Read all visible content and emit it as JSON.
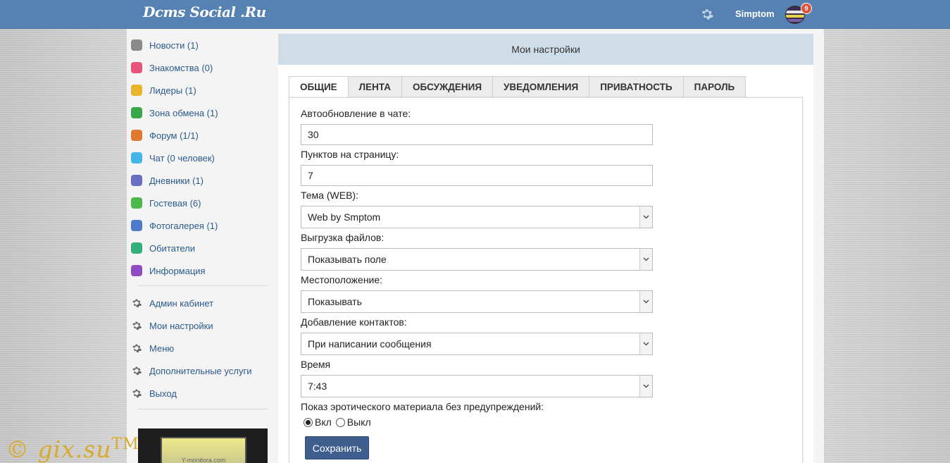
{
  "header": {
    "logo": "Dcms Social .Ru",
    "username": "Simptom",
    "notifications_count": "9"
  },
  "sidebar": {
    "items": [
      {
        "label": "Новости (1)",
        "icon": "news-icon",
        "color": "#8a8a8a"
      },
      {
        "label": "Знакомства (0)",
        "icon": "heart-icon",
        "color": "#e8557a"
      },
      {
        "label": "Лидеры (1)",
        "icon": "trophy-icon",
        "color": "#e8b52a"
      },
      {
        "label": "Зона обмена (1)",
        "icon": "exchange-icon",
        "color": "#3aa84a"
      },
      {
        "label": "Форум (1/1)",
        "icon": "forum-icon",
        "color": "#e07a30"
      },
      {
        "label": "Чат (0 человек)",
        "icon": "chat-icon",
        "color": "#45b4e6"
      },
      {
        "label": "Дневники (1)",
        "icon": "diary-icon",
        "color": "#6b6fc0"
      },
      {
        "label": "Гостевая (6)",
        "icon": "guestbook-icon",
        "color": "#4cb84c"
      },
      {
        "label": "Фотогалерея (1)",
        "icon": "camera-icon",
        "color": "#4f7ac8"
      },
      {
        "label": "Обитатели",
        "icon": "users-icon",
        "color": "#36b07a"
      },
      {
        "label": "Информация",
        "icon": "info-icon",
        "color": "#8e4cc0"
      }
    ],
    "settings_items": [
      {
        "label": "Админ кабинет"
      },
      {
        "label": "Мои настройки"
      },
      {
        "label": "Меню"
      },
      {
        "label": "Дополнительные услуги"
      },
      {
        "label": "Выход"
      }
    ],
    "ad_text": "Y-monitora.com"
  },
  "main": {
    "title": "Мои настройки",
    "tabs": [
      "ОБЩИЕ",
      "ЛЕНТА",
      "ОБСУЖДЕНИЯ",
      "УВЕДОМЛЕНИЯ",
      "ПРИВАТНОСТЬ",
      "ПАРОЛЬ"
    ],
    "active_tab": "ОБЩИЕ",
    "form": {
      "chat_refresh_label": "Автообновление в чате:",
      "chat_refresh_value": "30",
      "per_page_label": "Пунктов на страницу:",
      "per_page_value": "7",
      "theme_label": "Тема (WEB):",
      "theme_value": "Web by Smptom",
      "upload_label": "Выгрузка файлов:",
      "upload_value": "Показывать поле",
      "location_label": "Местоположение:",
      "location_value": "Показывать",
      "contacts_label": "Добавление контактов:",
      "contacts_value": "При написании сообщения",
      "time_label": "Время",
      "time_value": "7:43",
      "erotic_label": "Показ эротического материала без предупреждений:",
      "radio_on_label": "Вкл",
      "radio_off_label": "Выкл",
      "save_label": "Сохранить"
    }
  },
  "watermark": "© gix.su",
  "watermark_tm": "TM"
}
